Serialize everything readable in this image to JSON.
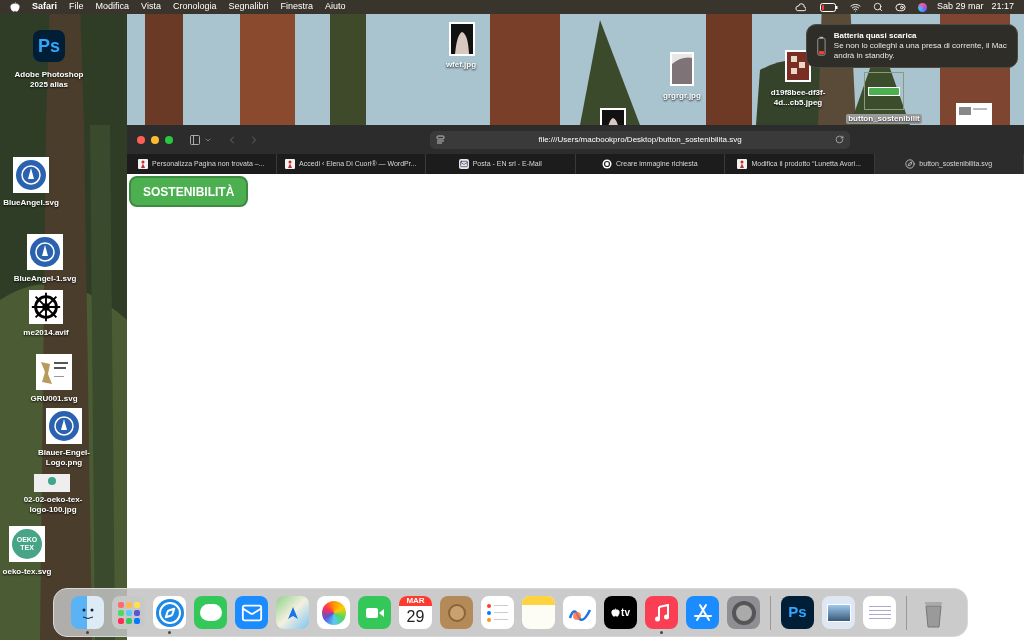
{
  "menu_bar": {
    "app": "Safari",
    "menus": [
      "File",
      "Modifica",
      "Vista",
      "Cronologia",
      "Segnalibri",
      "Finestra",
      "Aiuto"
    ],
    "date": "Sab 29 mar",
    "time": "21:17"
  },
  "desktop_icons": [
    {
      "kind": "photoshop",
      "text": "Ps",
      "label": "Adobe Photoshop 2025 alias"
    },
    {
      "kind": "blue-emblem",
      "label": "BlueAngel.svg"
    },
    {
      "kind": "blue-emblem",
      "label": "BlueAngel-1.svg"
    },
    {
      "kind": "wheel",
      "label": "me2014.avif"
    },
    {
      "kind": "leather",
      "label": "GRU001.svg"
    },
    {
      "kind": "blue-emblem",
      "label": "Blauer-Engel-Logo.png"
    },
    {
      "kind": "strip",
      "label": "02-02-oeko-tex-logo-100.jpg"
    },
    {
      "kind": "oeko",
      "text": "OEKO TEX",
      "label": "oeko-tex.svg"
    },
    {
      "kind": "photo-dark",
      "label": "wfef.jpg"
    },
    {
      "kind": "photo-light",
      "label": "grgrgr.jpg"
    },
    {
      "kind": "photo-red",
      "label": "d19f8bee-df3f-4d...cb5.jpeg"
    },
    {
      "kind": "button-thumb",
      "label": "button_sostenibilit"
    },
    {
      "kind": "photo-dark"
    },
    {
      "kind": "screenshot"
    }
  ],
  "notification": {
    "title": "Batteria quasi scarica",
    "body": "Se non lo colleghi a una presa di corrente, il Mac andrà in standby."
  },
  "browser": {
    "url": "file:///Users/macbookpro/Desktop/button_sostenibilita.svg",
    "tabs": [
      {
        "kind": "red-figure",
        "title": "Personalizza Pagina non trovata –...",
        "selected": false
      },
      {
        "kind": "red-figure",
        "title": "Accedi ‹ Elena Di Cuori® — WordPr...",
        "selected": false
      },
      {
        "kind": "mail",
        "title": "Posta - EN srl - E-Mail",
        "selected": false
      },
      {
        "kind": "swirl",
        "title": "Creare immagine richiesta",
        "selected": false
      },
      {
        "kind": "red-figure",
        "title": "Modifica il prodotto “Lunetta Avori...",
        "selected": false
      },
      {
        "kind": "compass",
        "title": "button_sostenibilita.svg",
        "selected": true
      }
    ],
    "page_button": "SOSTENIBILITÀ"
  },
  "dock": [
    {
      "kind": "finder",
      "running": true
    },
    {
      "kind": "launchpad",
      "running": false
    },
    {
      "kind": "safari",
      "running": true
    },
    {
      "kind": "messages",
      "running": false
    },
    {
      "kind": "mail",
      "running": false
    },
    {
      "kind": "maps",
      "running": false
    },
    {
      "kind": "photos",
      "running": false
    },
    {
      "kind": "facetime",
      "running": false
    },
    {
      "kind": "calendar",
      "month": "MAR",
      "day": "29",
      "running": false
    },
    {
      "kind": "contacts",
      "running": false
    },
    {
      "kind": "reminders",
      "running": false
    },
    {
      "kind": "notes",
      "running": false
    },
    {
      "kind": "freeform",
      "running": false
    },
    {
      "kind": "tv",
      "text": "tv",
      "running": false
    },
    {
      "kind": "music",
      "running": true
    },
    {
      "kind": "appstore",
      "running": false
    },
    {
      "kind": "settings",
      "running": false
    },
    {
      "kind": "separator"
    },
    {
      "kind": "photoshop",
      "text": "Ps",
      "running": false
    },
    {
      "kind": "preview",
      "running": false
    },
    {
      "kind": "textedit",
      "running": false
    },
    {
      "kind": "separator"
    },
    {
      "kind": "trash",
      "running": false
    }
  ]
}
